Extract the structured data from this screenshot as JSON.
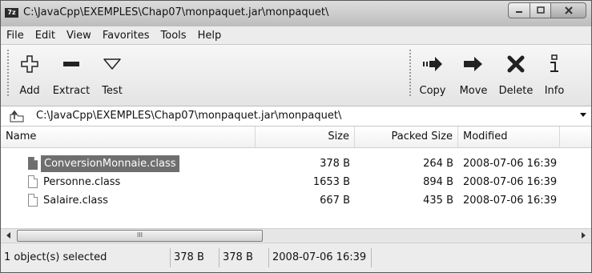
{
  "window": {
    "app_icon_text": "7z",
    "title": "C:\\JavaCpp\\EXEMPLES\\Chap07\\monpaquet.jar\\monpaquet\\"
  },
  "menu": [
    "File",
    "Edit",
    "View",
    "Favorites",
    "Tools",
    "Help"
  ],
  "toolbar": {
    "add": "Add",
    "extract": "Extract",
    "test": "Test",
    "copy": "Copy",
    "move": "Move",
    "delete": "Delete",
    "info": "Info"
  },
  "address": {
    "path": "C:\\JavaCpp\\EXEMPLES\\Chap07\\monpaquet.jar\\monpaquet\\"
  },
  "list": {
    "columns": {
      "name": "Name",
      "size": "Size",
      "packed": "Packed Size",
      "modified": "Modified"
    },
    "rows": [
      {
        "name": "ConversionMonnaie.class",
        "size": "378 B",
        "packed": "264 B",
        "modified": "2008-07-06 16:39",
        "selected": true
      },
      {
        "name": "Personne.class",
        "size": "1653 B",
        "packed": "894 B",
        "modified": "2008-07-06 16:39",
        "selected": false
      },
      {
        "name": "Salaire.class",
        "size": "667 B",
        "packed": "435 B",
        "modified": "2008-07-06 16:39",
        "selected": false
      }
    ]
  },
  "scrollbar": {
    "thumb_grip": "III"
  },
  "status": {
    "selected": "1 object(s) selected",
    "size": "378 B",
    "packed": "378 B",
    "modified": "2008-07-06 16:39"
  }
}
